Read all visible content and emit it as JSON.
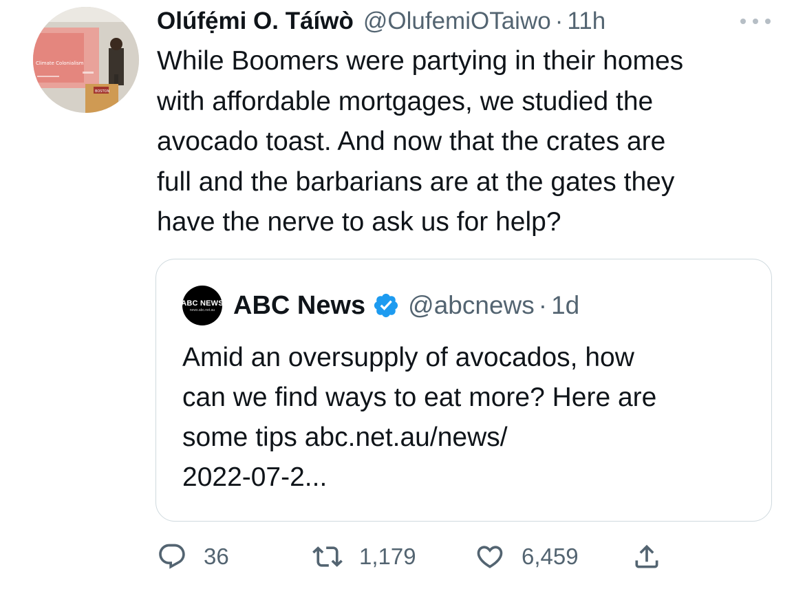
{
  "tweet": {
    "display_name": "Olúfẹ́mi O. Táíwò",
    "handle": "@OlufemiOTaiwo",
    "separator": "·",
    "time": "11h",
    "text_lines": [
      "While Boomers were partying in their homes",
      "with affordable mortgages, we studied the",
      "avocado toast. And now that the crates are",
      "full and the barbarians are at the gates they",
      "have the nerve to ask us for help?"
    ],
    "avatar_slide_title": "Climate Colonialism",
    "avatar_podium_text": "BOSTON"
  },
  "quote": {
    "avatar_logo": "ABC NEWS",
    "avatar_sub": "news.abc.net.au",
    "display_name": "ABC News",
    "handle": "@abcnews",
    "separator": "·",
    "time": "1d",
    "text_lines": [
      "Amid an oversupply of avocados, how",
      "can we find ways to eat more? Here are",
      "some tips abc.net.au/news/",
      "2022-07-2..."
    ]
  },
  "actions": {
    "replies": "36",
    "retweets": "1,179",
    "likes": "6,459"
  },
  "icons": [
    "more-icon",
    "verified-icon",
    "reply-icon",
    "retweet-icon",
    "like-icon",
    "share-icon"
  ],
  "colors": {
    "text_primary": "#0f1419",
    "text_secondary": "#536471",
    "verified": "#1d9bf0",
    "border": "#cfd9de"
  }
}
